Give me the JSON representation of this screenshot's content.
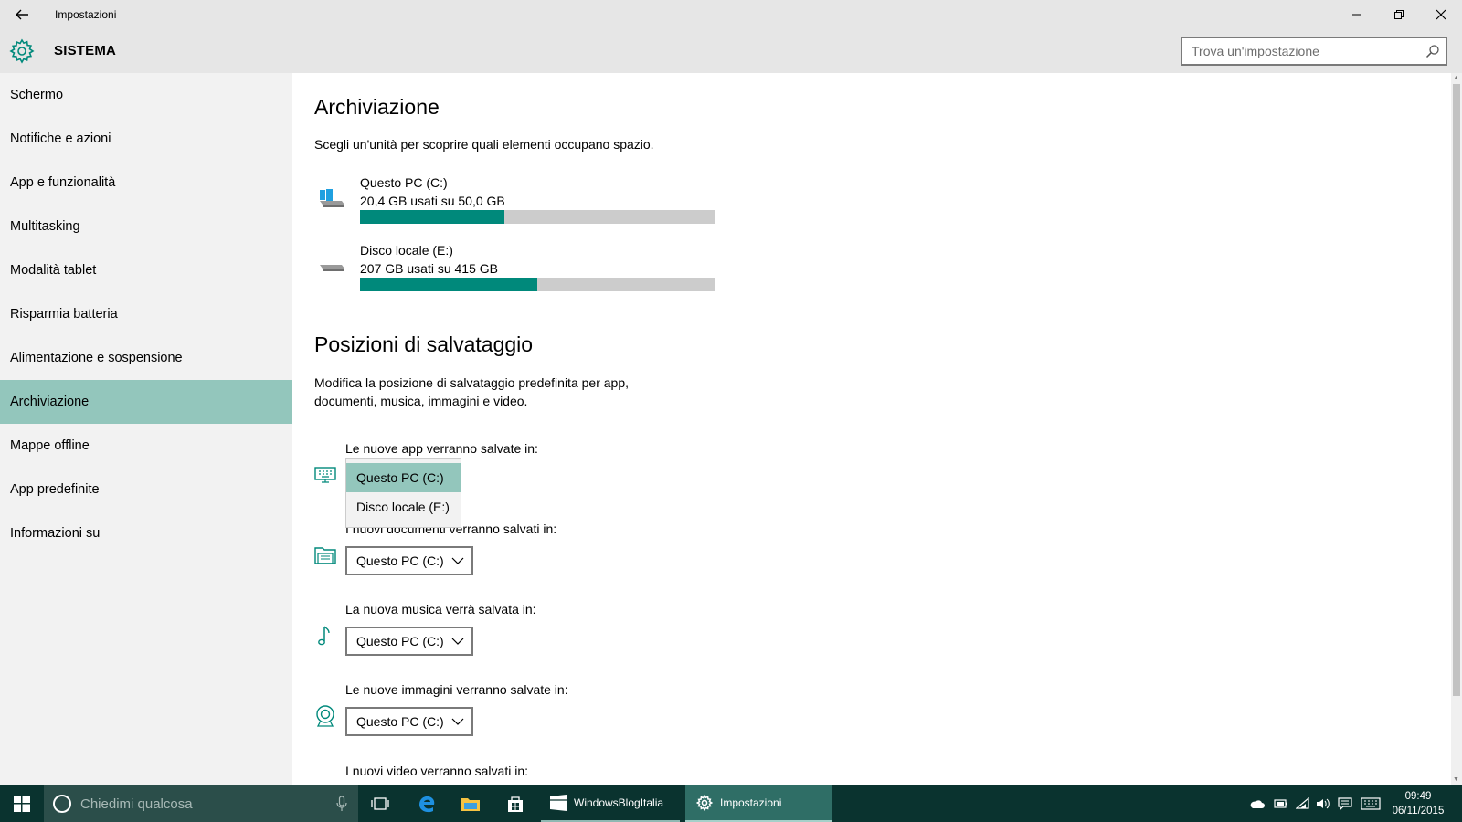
{
  "window": {
    "title": "Impostazioni",
    "back_icon": "back-arrow-icon",
    "controls": [
      "minimize-icon",
      "restore-icon",
      "close-icon"
    ]
  },
  "header": {
    "section_title": "SISTEMA",
    "section_icon": "gear-icon",
    "search_placeholder": "Trova un'impostazione"
  },
  "sidebar": {
    "items": [
      {
        "label": "Schermo",
        "active": false
      },
      {
        "label": "Notifiche e azioni",
        "active": false
      },
      {
        "label": "App e funzionalità",
        "active": false
      },
      {
        "label": "Multitasking",
        "active": false
      },
      {
        "label": "Modalità tablet",
        "active": false
      },
      {
        "label": "Risparmia batteria",
        "active": false
      },
      {
        "label": "Alimentazione e sospensione",
        "active": false
      },
      {
        "label": "Archiviazione",
        "active": true
      },
      {
        "label": "Mappe offline",
        "active": false
      },
      {
        "label": "App predefinite",
        "active": false
      },
      {
        "label": "Informazioni su",
        "active": false
      }
    ]
  },
  "storage": {
    "title": "Archiviazione",
    "description": "Scegli un'unità per scoprire quali elementi occupano spazio.",
    "drives": [
      {
        "name": "Questo PC (C:)",
        "usage": "20,4 GB usati su 50,0 GB",
        "used_fraction": 0.408,
        "icon": "windows-drive-icon"
      },
      {
        "name": "Disco locale (E:)",
        "usage": "207 GB usati su 415 GB",
        "used_fraction": 0.4988,
        "icon": "hard-drive-icon"
      }
    ]
  },
  "save_locations": {
    "title": "Posizioni di salvataggio",
    "description_line1": "Modifica la posizione di salvataggio predefinita per app,",
    "description_line2": "documenti, musica, immagini e video.",
    "apps_label": "Le nuove app verranno salvate in:",
    "apps_options": [
      "Questo PC (C:)",
      "Disco locale (E:)"
    ],
    "apps_selected": "Questo PC (C:)",
    "documents_label": "I nuovi documenti verranno salvati in:",
    "documents_value": "Questo PC (C:)",
    "music_label": "La nuova musica verrà salvata in:",
    "music_value": "Questo PC (C:)",
    "pictures_label": "Le nuove immagini verranno salvate in:",
    "pictures_value": "Questo PC (C:)",
    "videos_label": "I nuovi video verranno salvati in:"
  },
  "taskbar": {
    "search_placeholder": "Chiedimi qualcosa",
    "apps": [
      {
        "label": "WindowsBlogItalia",
        "state": "running"
      },
      {
        "label": "Impostazioni",
        "state": "active"
      }
    ],
    "clock_time": "09:49",
    "clock_date": "06/11/2015"
  },
  "colors": {
    "accent": "#00897b",
    "selection": "#93c6bc",
    "taskbar": "#0a332f",
    "chrome": "#e6e6e6"
  }
}
